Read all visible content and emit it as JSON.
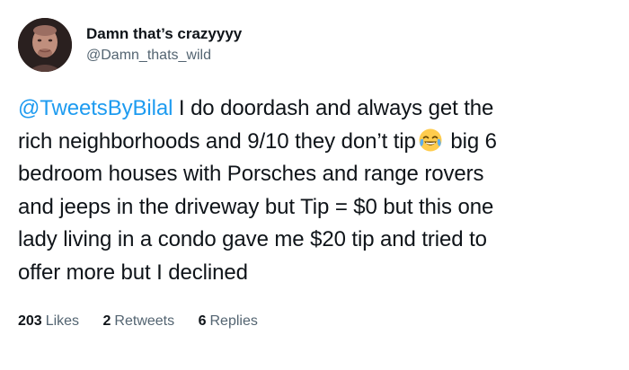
{
  "author": {
    "display_name": "Damn that’s crazyyyy",
    "handle": "@Damn_thats_wild",
    "avatar_icon": "profile-photo"
  },
  "tweet": {
    "mention": "@TweetsByBilal",
    "lines": [
      " I do doordash and always get the",
      "rich neighborhoods and 9/10 they don’t tip",
      " big 6",
      "bedroom houses with Porsches and range rovers",
      "and jeeps in the driveway but Tip = $0 but this one",
      "lady living in a condo gave me $20 tip and tried to",
      "offer more but I declined"
    ],
    "emoji_icon": "face-with-tears-of-joy"
  },
  "stats": {
    "likes_count": "203",
    "likes_label": "Likes",
    "retweets_count": "2",
    "retweets_label": "Retweets",
    "replies_count": "6",
    "replies_label": "Replies"
  },
  "colors": {
    "mention": "#1d9bf0",
    "secondary_text": "#536471",
    "primary_text": "#0f1419"
  }
}
